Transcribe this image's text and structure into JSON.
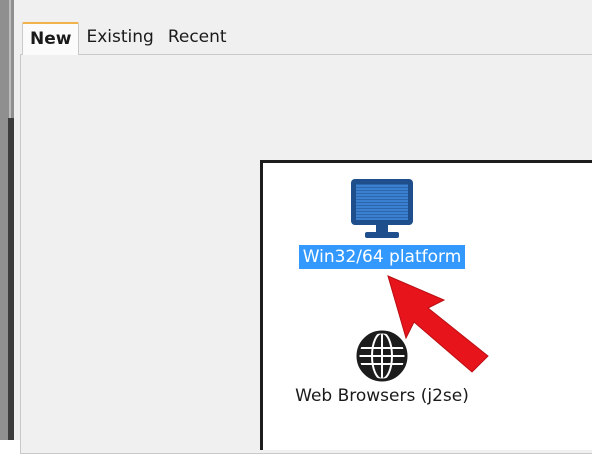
{
  "tabs": [
    {
      "label": "New",
      "active": true
    },
    {
      "label": "Existing",
      "active": false
    },
    {
      "label": "Recent",
      "active": false
    }
  ],
  "items": [
    {
      "label": "Win32/64 platform",
      "icon": "monitor-icon",
      "selected": true
    },
    {
      "label": "Web Browsers (j2se)",
      "icon": "globe-icon",
      "selected": false
    }
  ],
  "colors": {
    "selection": "#3399ff",
    "active_tab_accent": "#f0b24a",
    "annotation_arrow": "#e8141b"
  }
}
